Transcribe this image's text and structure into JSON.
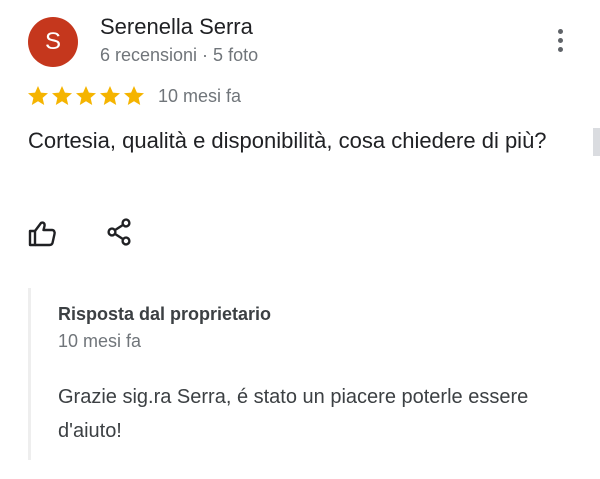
{
  "review": {
    "avatar_letter": "S",
    "author_name": "Serenella Serra",
    "author_meta": "6 recensioni · 5 foto",
    "rating": 5,
    "rating_max": 5,
    "date": "10 mesi fa",
    "text": "Cortesia, qualità e disponibilità, cosa chiedere di più?",
    "avatar_color": "#c5371d",
    "star_color": "#f5b400"
  },
  "actions": {
    "like_icon": "thumbs-up-icon",
    "share_icon": "share-icon",
    "menu_icon": "more-vert-icon"
  },
  "owner_response": {
    "title": "Risposta dal proprietario",
    "date": "10 mesi fa",
    "text": "Grazie sig.ra Serra, é stato un piacere poterle essere d'aiuto!"
  }
}
